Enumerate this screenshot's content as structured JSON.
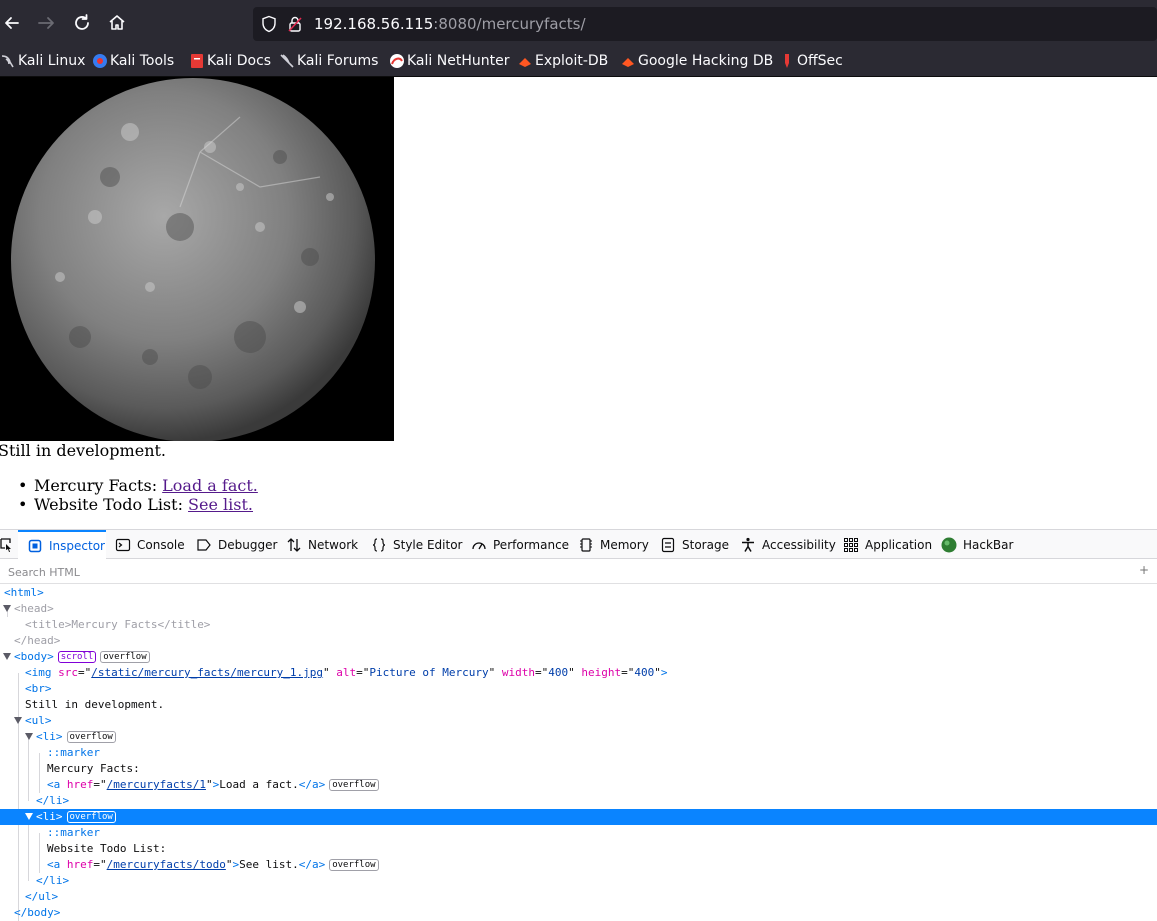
{
  "browser": {
    "url_host": "192.168.56.115",
    "url_port": ":8080",
    "url_path": "/mercuryfacts/",
    "bookmarks": [
      {
        "label": "Kali Linux",
        "icon": "kali-dragon-icon"
      },
      {
        "label": "Kali Tools",
        "icon": "kali-tools-icon"
      },
      {
        "label": "Kali Docs",
        "icon": "kali-docs-icon"
      },
      {
        "label": "Kali Forums",
        "icon": "kali-forums-icon"
      },
      {
        "label": "Kali NetHunter",
        "icon": "nethunter-icon"
      },
      {
        "label": "Exploit-DB",
        "icon": "exploit-db-icon"
      },
      {
        "label": "Google Hacking DB",
        "icon": "ghdb-icon"
      },
      {
        "label": "OffSec",
        "icon": "offsec-icon"
      }
    ]
  },
  "page": {
    "image_alt": "Picture of Mercury",
    "still_text": "Still in development.",
    "items": [
      {
        "label": "Mercury Facts: ",
        "link": "Load a fact."
      },
      {
        "label": "Website Todo List: ",
        "link": "See list."
      }
    ]
  },
  "devtools": {
    "tabs": [
      {
        "label": "Inspector",
        "icon": "inspector-icon"
      },
      {
        "label": "Console",
        "icon": "console-icon"
      },
      {
        "label": "Debugger",
        "icon": "debugger-icon"
      },
      {
        "label": "Network",
        "icon": "network-icon"
      },
      {
        "label": "Style Editor",
        "icon": "style-editor-icon"
      },
      {
        "label": "Performance",
        "icon": "performance-icon"
      },
      {
        "label": "Memory",
        "icon": "memory-icon"
      },
      {
        "label": "Storage",
        "icon": "storage-icon"
      },
      {
        "label": "Accessibility",
        "icon": "accessibility-icon"
      },
      {
        "label": "Application",
        "icon": "application-icon"
      },
      {
        "label": "HackBar",
        "icon": "hackbar-icon"
      }
    ],
    "search_placeholder": "Search HTML",
    "search_plus": "+",
    "markup": {
      "html_open": "<html>",
      "head_open": "<head>",
      "title_open": "<title>",
      "title_text": "Mercury Facts",
      "title_close": "</title>",
      "head_close": "</head>",
      "body_open": "<body>",
      "badge_scroll": "scroll",
      "badge_overflow": "overflow",
      "img_tag": "<img",
      "attr_src": "src",
      "val_src": "/static/mercury_facts/mercury_1.jpg",
      "attr_alt": "alt",
      "val_alt": "Picture of Mercury",
      "attr_width": "width",
      "val_width": "400",
      "attr_height": "height",
      "val_height": "400",
      "br": "<br>",
      "text_still": "Still in development.",
      "ul_open": "<ul>",
      "li_open": "<li>",
      "marker": "::marker",
      "text_facts": "Mercury Facts:",
      "a_open": "<a",
      "attr_href": "href",
      "val_href1": "/mercuryfacts/1",
      "link1_text": "Load a fact.",
      "a_close": "</a>",
      "li_close": "</li>",
      "text_todo": "Website Todo List:",
      "val_href2": "/mercuryfacts/todo",
      "link2_text": "See list.",
      "ul_close": "</ul>",
      "body_close": "</body>"
    }
  },
  "colors": {
    "toolbar_bg": "#2b2a33",
    "url_bg": "#1c1b22",
    "link_visited": "#551a8b",
    "selection": "#0a84ff"
  }
}
